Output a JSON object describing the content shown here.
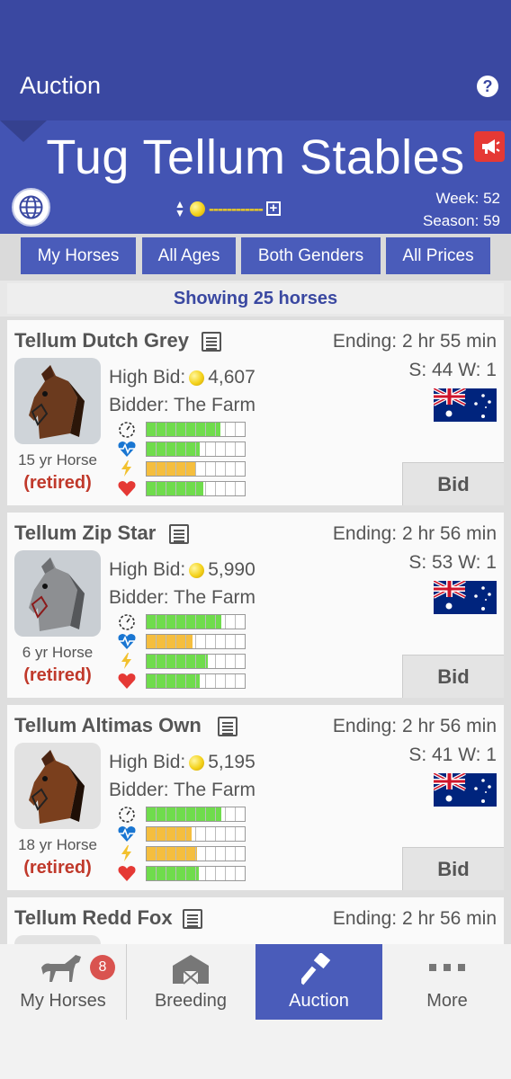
{
  "header": {
    "title": "Auction"
  },
  "stable": {
    "name": "Tug Tellum Stables",
    "coin_display": "------------",
    "week": "Week: 52",
    "season": "Season: 59"
  },
  "filters": [
    "My Horses",
    "All Ages",
    "Both Genders",
    "All Prices"
  ],
  "showing": "Showing 25 horses",
  "horses": [
    {
      "name": "Tellum Dutch Grey",
      "ending": "Ending: 2 hr 55 min",
      "record": "S: 44 W: 1",
      "high_bid_label": "High Bid:",
      "high_bid": "4,607",
      "bidder": "Bidder: The Farm",
      "age": "15 yr Horse",
      "status": "(retired)",
      "coat": "bay",
      "stats": [
        {
          "name": "speed",
          "level": 0.75,
          "color": "#6fdc4c"
        },
        {
          "name": "stamina",
          "level": 0.54,
          "color": "#6fdc4c"
        },
        {
          "name": "energy",
          "level": 0.5,
          "color": "#f5be3e"
        },
        {
          "name": "health",
          "level": 0.58,
          "color": "#6fdc4c"
        }
      ],
      "bid_label": "Bid"
    },
    {
      "name": "Tellum Zip Star",
      "ending": "Ending: 2 hr 56 min",
      "record": "S: 53 W: 1",
      "high_bid_label": "High Bid:",
      "high_bid": "5,990",
      "bidder": "Bidder: The Farm",
      "age": "6 yr Horse",
      "status": "(retired)",
      "coat": "grey",
      "stats": [
        {
          "name": "speed",
          "level": 0.76,
          "color": "#6fdc4c"
        },
        {
          "name": "stamina",
          "level": 0.47,
          "color": "#f5be3e"
        },
        {
          "name": "energy",
          "level": 0.62,
          "color": "#6fdc4c"
        },
        {
          "name": "health",
          "level": 0.54,
          "color": "#6fdc4c"
        }
      ],
      "bid_label": "Bid"
    },
    {
      "name": "Tellum Altimas Own",
      "ending": "Ending: 2 hr 56 min",
      "record": "S: 41 W: 1",
      "high_bid_label": "High Bid:",
      "high_bid": "5,195",
      "bidder": "Bidder: The Farm",
      "age": "18 yr Horse",
      "status": "(retired)",
      "coat": "bay",
      "stats": [
        {
          "name": "speed",
          "level": 0.76,
          "color": "#6fdc4c"
        },
        {
          "name": "stamina",
          "level": 0.46,
          "color": "#f5be3e"
        },
        {
          "name": "energy",
          "level": 0.51,
          "color": "#f5be3e"
        },
        {
          "name": "health",
          "level": 0.53,
          "color": "#6fdc4c"
        }
      ],
      "bid_label": "Bid"
    },
    {
      "name": "Tellum Redd Fox",
      "ending": "Ending: 2 hr 56 min",
      "record": "",
      "high_bid_label": "",
      "high_bid": "",
      "bidder": "",
      "age": "",
      "status": "",
      "coat": "bay",
      "stats": [],
      "bid_label": ""
    }
  ],
  "bottom_nav": {
    "items": [
      "My Horses",
      "Breeding",
      "Auction",
      "More"
    ],
    "badge": "8",
    "active": "Auction"
  }
}
